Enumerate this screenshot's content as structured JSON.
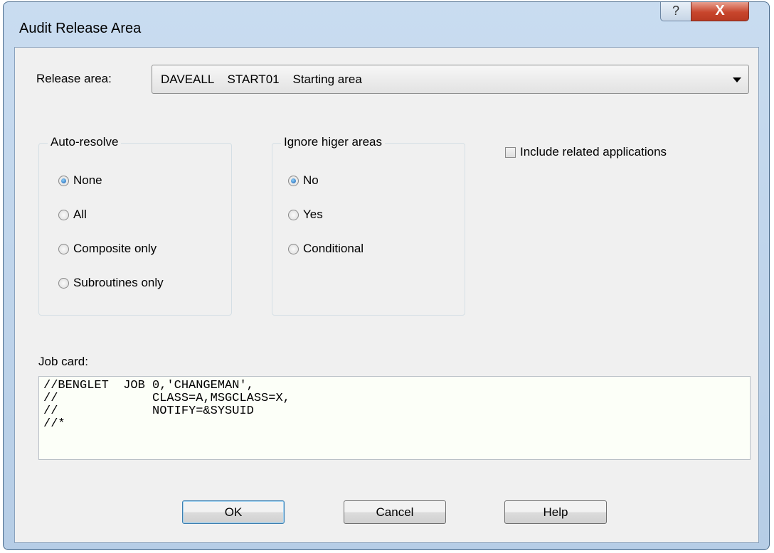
{
  "window": {
    "title": "Audit Release Area",
    "help_glyph": "?",
    "close_glyph": "X"
  },
  "release_area": {
    "label": "Release area:",
    "selected": "DAVEALL    START01    Starting area"
  },
  "auto_resolve": {
    "legend": "Auto-resolve",
    "options": [
      {
        "label": "None",
        "selected": true
      },
      {
        "label": "All",
        "selected": false
      },
      {
        "label": "Composite only",
        "selected": false
      },
      {
        "label": "Subroutines only",
        "selected": false
      }
    ]
  },
  "ignore_higher": {
    "legend": "Ignore higer areas",
    "options": [
      {
        "label": "No",
        "selected": true
      },
      {
        "label": "Yes",
        "selected": false
      },
      {
        "label": "Conditional",
        "selected": false
      }
    ]
  },
  "include_related": {
    "label": "Include related applications",
    "checked": false
  },
  "job_card": {
    "label": "Job card:",
    "text": "//BENGLET  JOB 0,'CHANGEMAN',\n//             CLASS=A,MSGCLASS=X,\n//             NOTIFY=&SYSUID\n//*"
  },
  "buttons": {
    "ok": "OK",
    "cancel": "Cancel",
    "help": "Help"
  }
}
